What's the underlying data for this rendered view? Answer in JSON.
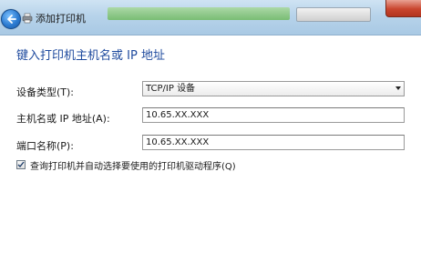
{
  "window": {
    "title": "添加打印机"
  },
  "page": {
    "heading": "键入打印机主机名或 IP 地址"
  },
  "form": {
    "device_type": {
      "label": "设备类型(T):",
      "value": "TCP/IP 设备"
    },
    "hostname": {
      "label": "主机名或 IP 地址(A):",
      "value": "10.65.XX.XXX"
    },
    "port_name": {
      "label": "端口名称(P):",
      "value": "10.65.XX.XXX"
    },
    "query_printer": {
      "label": "查询打印机并自动选择要使用的打印机驱动程序(Q)",
      "checked": true
    }
  },
  "icons": {
    "back": "back-arrow-icon",
    "printer": "printer-icon",
    "dropdown": "chevron-down-icon",
    "checkmark": "checkmark-icon"
  },
  "colors": {
    "heading": "#1e4a9e",
    "titlebar": "#b7d3ea",
    "close": "#c9452e",
    "back_button": "#2d7cd1"
  }
}
